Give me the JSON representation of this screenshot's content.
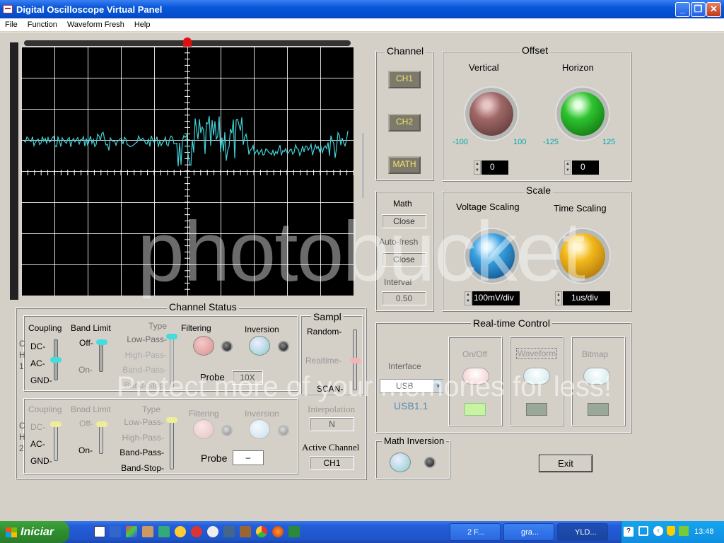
{
  "window": {
    "title": "Digital Oscilloscope Virtual Panel"
  },
  "menu": [
    "File",
    "Function",
    "Waveform Fresh",
    "Help"
  ],
  "channel_group": {
    "legend": "Channel",
    "ch1": "CH1",
    "ch2": "CH2",
    "math": "MATH"
  },
  "offset": {
    "legend": "Offset",
    "vertical": {
      "label": "Vertical",
      "min": "-100",
      "max": "100",
      "value": "0"
    },
    "horizon": {
      "label": "Horizon",
      "min": "-125",
      "max": "125",
      "value": "0"
    }
  },
  "math_box": {
    "math_label": "Math",
    "math_value": "Close",
    "autofresh_label": "Auto-fresh",
    "autofresh_value": "Close",
    "interval_label": "Interval",
    "interval_value": "0.50"
  },
  "scale": {
    "legend": "Scale",
    "voltage": {
      "label": "Voltage Scaling",
      "value": "100mV/div"
    },
    "time": {
      "label": "Time Scaling",
      "value": "1us/div"
    }
  },
  "channel_status": {
    "legend": "Channel Status",
    "headers": {
      "coupling": "Coupling",
      "band_limit": "Band Limit",
      "type": "Type",
      "filtering": "Filtering",
      "inversion": "Inversion"
    },
    "ch1_label": [
      "C",
      "H",
      "1"
    ],
    "ch2_label": [
      "C",
      "H",
      "2"
    ],
    "ch2_band_header": "Bnad Limit",
    "coupling_opts": [
      "DC-",
      "AC-",
      "GND-"
    ],
    "band_opts": [
      "Off-",
      "On-"
    ],
    "type_opts": [
      "Low-Pass-",
      "High-Pass-",
      "Band-Pass-",
      "Band-Stop-"
    ],
    "probe_label": "Probe",
    "ch1_probe": "10X",
    "ch2_probe": "–"
  },
  "sampl": {
    "legend": "Sampl",
    "opts": [
      "Random-",
      "Realtime-",
      "SCAN-"
    ]
  },
  "interpolation": {
    "label": "Interpolation",
    "value": "N"
  },
  "active_channel": {
    "label": "Active Channel",
    "value": "CH1"
  },
  "realtime": {
    "legend": "Real-time Control",
    "interface_label": "Interface",
    "interface_value": "USB",
    "interface_version": "USB1.1",
    "onoff": "On/Off",
    "waveform": "Waveform",
    "bitmap": "Bitmap"
  },
  "math_inversion": {
    "legend": "Math Inversion"
  },
  "exit": "Exit",
  "watermark": {
    "main": "photobucket",
    "sub": "Protect more of your memories for less!"
  },
  "taskbar": {
    "start": "Iniciar",
    "tasks": [
      "2 F...",
      "gra...",
      "YLD..."
    ],
    "clock": "13:48"
  },
  "colors": {
    "trace": "#43d1d9",
    "grid": "#ffffff",
    "scope_bg": "#000000",
    "button_text": "#f6e56a",
    "trigger": "#e01010"
  }
}
